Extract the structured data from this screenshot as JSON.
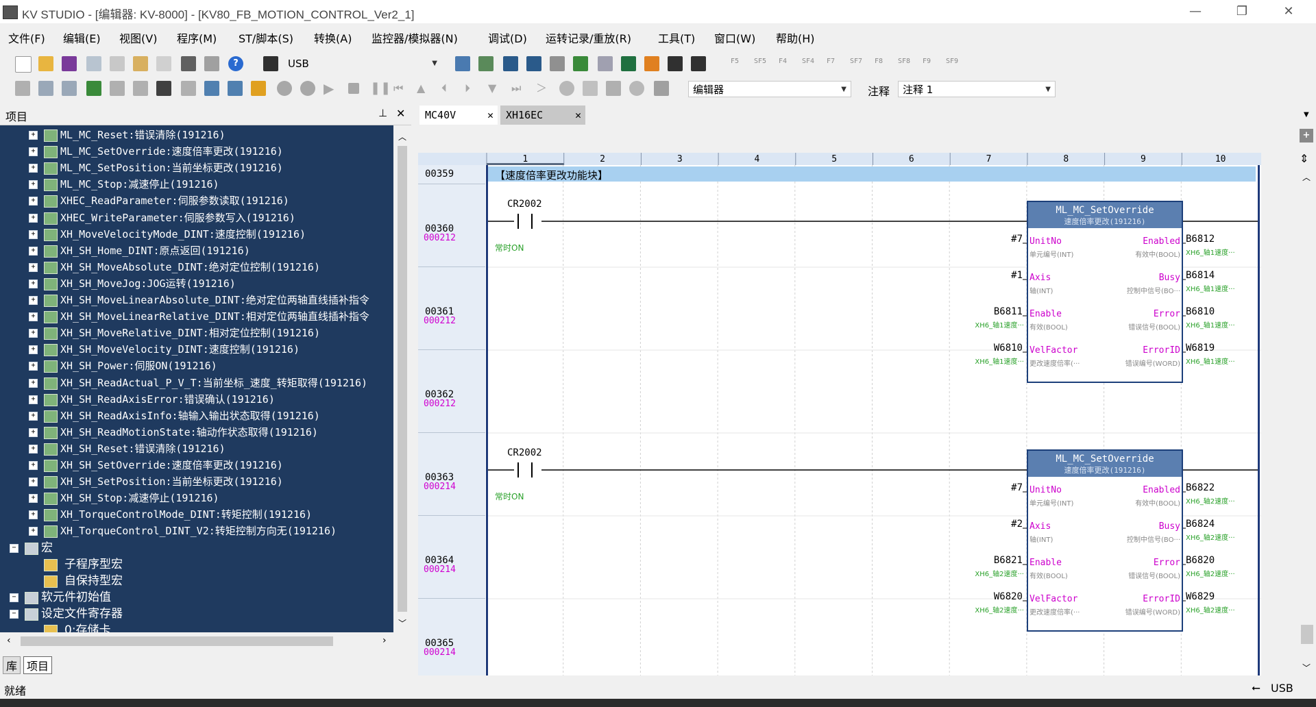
{
  "window": {
    "title": "KV STUDIO - [编辑器: KV-8000] - [KV80_FB_MOTION_CONTROL_Ver2_1]",
    "minimize": "—",
    "restore": "❐",
    "close": "✕"
  },
  "menu": [
    "文件(F)",
    "编辑(E)",
    "视图(V)",
    "程序(M)",
    "ST/脚本(S)",
    "转换(A)",
    "监控器/模拟器(N)",
    "调试(D)",
    "运转记录/重放(R)",
    "工具(T)",
    "窗口(W)",
    "帮助(H)"
  ],
  "toolbar": {
    "connection": "USB",
    "fkeys": [
      "F5",
      "SF5",
      "F4",
      "SF4",
      "F7",
      "SF7",
      "F8",
      "SF8",
      "F9",
      "SF9"
    ],
    "mode": "编辑器",
    "comment_label": "注释",
    "comment_value": "注释 1"
  },
  "project": {
    "title": "项目",
    "pin": "ꟾ",
    "close": "✕",
    "items": [
      {
        "text": "ML_MC_Reset:错误清除(191216)",
        "level": 1
      },
      {
        "text": "ML_MC_SetOverride:速度倍率更改(191216)",
        "level": 1
      },
      {
        "text": "ML_MC_SetPosition:当前坐标更改(191216)",
        "level": 1
      },
      {
        "text": "ML_MC_Stop:减速停止(191216)",
        "level": 1
      },
      {
        "text": "XHEC_ReadParameter:伺服参数读取(191216)",
        "level": 1
      },
      {
        "text": "XHEC_WriteParameter:伺服参数写入(191216)",
        "level": 1
      },
      {
        "text": "XH_MoveVelocityMode_DINT:速度控制(191216)",
        "level": 1
      },
      {
        "text": "XH_SH_Home_DINT:原点返回(191216)",
        "level": 1
      },
      {
        "text": "XH_SH_MoveAbsolute_DINT:绝对定位控制(191216)",
        "level": 1
      },
      {
        "text": "XH_SH_MoveJog:JOG运转(191216)",
        "level": 1
      },
      {
        "text": "XH_SH_MoveLinearAbsolute_DINT:绝对定位两轴直线插补指令",
        "level": 1
      },
      {
        "text": "XH_SH_MoveLinearRelative_DINT:相对定位两轴直线插补指令",
        "level": 1
      },
      {
        "text": "XH_SH_MoveRelative_DINT:相对定位控制(191216)",
        "level": 1
      },
      {
        "text": "XH_SH_MoveVelocity_DINT:速度控制(191216)",
        "level": 1
      },
      {
        "text": "XH_SH_Power:伺服ON(191216)",
        "level": 1
      },
      {
        "text": "XH_SH_ReadActual_P_V_T:当前坐标_速度_转矩取得(191216)",
        "level": 1
      },
      {
        "text": "XH_SH_ReadAxisError:错误确认(191216)",
        "level": 1
      },
      {
        "text": "XH_SH_ReadAxisInfo:轴输入输出状态取得(191216)",
        "level": 1
      },
      {
        "text": "XH_SH_ReadMotionState:轴动作状态取得(191216)",
        "level": 1
      },
      {
        "text": "XH_SH_Reset:错误清除(191216)",
        "level": 1
      },
      {
        "text": "XH_SH_SetOverride:速度倍率更改(191216)",
        "level": 1
      },
      {
        "text": "XH_SH_SetPosition:当前坐标更改(191216)",
        "level": 1
      },
      {
        "text": "XH_SH_Stop:减速停止(191216)",
        "level": 1
      },
      {
        "text": "XH_TorqueControlMode_DINT:转矩控制(191216)",
        "level": 1
      },
      {
        "text": "XH_TorqueControl_DINT_V2:转矩控制方向无(191216)",
        "level": 1
      },
      {
        "text": "宏",
        "level": 0
      },
      {
        "text": "子程序型宏",
        "level": 2
      },
      {
        "text": "自保持型宏",
        "level": 2
      },
      {
        "text": "软元件初始值",
        "level": 0
      },
      {
        "text": "设定文件寄存器",
        "level": 0
      },
      {
        "text": "0:存储卡",
        "level": 2
      }
    ],
    "bottom_tabs": [
      "库",
      "项目"
    ]
  },
  "editor": {
    "tabs": [
      "MC40V",
      "XH16EC"
    ],
    "columns": [
      "1",
      "2",
      "3",
      "4",
      "5",
      "6",
      "7",
      "8",
      "9",
      "10"
    ],
    "rows": [
      {
        "num": "00359",
        "step": ""
      },
      {
        "num": "00360",
        "step": "000212"
      },
      {
        "num": "00361",
        "step": "000212"
      },
      {
        "num": "00362",
        "step": "000212"
      },
      {
        "num": "00363",
        "step": "000214"
      },
      {
        "num": "00364",
        "step": "000214"
      },
      {
        "num": "00365",
        "step": "000214"
      }
    ],
    "section_comment": "【速度倍率更改功能块】",
    "blocks": [
      {
        "contact": "CR2002",
        "contact_comment": "常时ON",
        "fb_name": "ML_MC_SetOverride",
        "fb_desc": "速度倍率更改(191216)",
        "inputs": [
          {
            "dev": "#7",
            "pin": "UnitNo",
            "sub": "单元编号(INT)",
            "cmt": ""
          },
          {
            "dev": "#1",
            "pin": "Axis",
            "sub": "轴(INT)",
            "cmt": ""
          },
          {
            "dev": "B6811",
            "pin": "Enable",
            "sub": "有效(BOOL)",
            "cmt": "XH6_轴1速度···"
          },
          {
            "dev": "W6810",
            "pin": "VelFactor",
            "sub": "更改速度倍率(···",
            "cmt": "XH6_轴1速度···"
          }
        ],
        "outputs": [
          {
            "dev": "B6812",
            "pin": "Enabled",
            "sub": "有效中(BOOL)",
            "cmt": "XH6_轴1速度···"
          },
          {
            "dev": "B6814",
            "pin": "Busy",
            "sub": "控制中信号(BO···",
            "cmt": "XH6_轴1速度···"
          },
          {
            "dev": "B6810",
            "pin": "Error",
            "sub": "错误信号(BOOL)",
            "cmt": "XH6_轴1速度···"
          },
          {
            "dev": "W6819",
            "pin": "ErrorID",
            "sub": "错误编号(WORD)",
            "cmt": "XH6_轴1速度···"
          }
        ]
      },
      {
        "contact": "CR2002",
        "contact_comment": "常时ON",
        "fb_name": "ML_MC_SetOverride",
        "fb_desc": "速度倍率更改(191216)",
        "inputs": [
          {
            "dev": "#7",
            "pin": "UnitNo",
            "sub": "单元编号(INT)",
            "cmt": ""
          },
          {
            "dev": "#2",
            "pin": "Axis",
            "sub": "轴(INT)",
            "cmt": ""
          },
          {
            "dev": "B6821",
            "pin": "Enable",
            "sub": "有效(BOOL)",
            "cmt": "XH6_轴2速度···"
          },
          {
            "dev": "W6820",
            "pin": "VelFactor",
            "sub": "更改速度倍率(···",
            "cmt": "XH6_轴2速度···"
          }
        ],
        "outputs": [
          {
            "dev": "B6822",
            "pin": "Enabled",
            "sub": "有效中(BOOL)",
            "cmt": "XH6_轴2速度···"
          },
          {
            "dev": "B6824",
            "pin": "Busy",
            "sub": "控制中信号(BO···",
            "cmt": "XH6_轴2速度···"
          },
          {
            "dev": "B6820",
            "pin": "Error",
            "sub": "错误信号(BOOL)",
            "cmt": "XH6_轴2速度···"
          },
          {
            "dev": "W6829",
            "pin": "ErrorID",
            "sub": "错误编号(WORD)",
            "cmt": "XH6_轴2速度···"
          }
        ]
      }
    ]
  },
  "status": {
    "left": "就绪",
    "right": "USB"
  },
  "colors": {
    "tree_bg": "#1f3a5f",
    "fb_header": "#5b7fb0",
    "step_color": "#d000d0",
    "section_bg": "#a8d0f0"
  }
}
